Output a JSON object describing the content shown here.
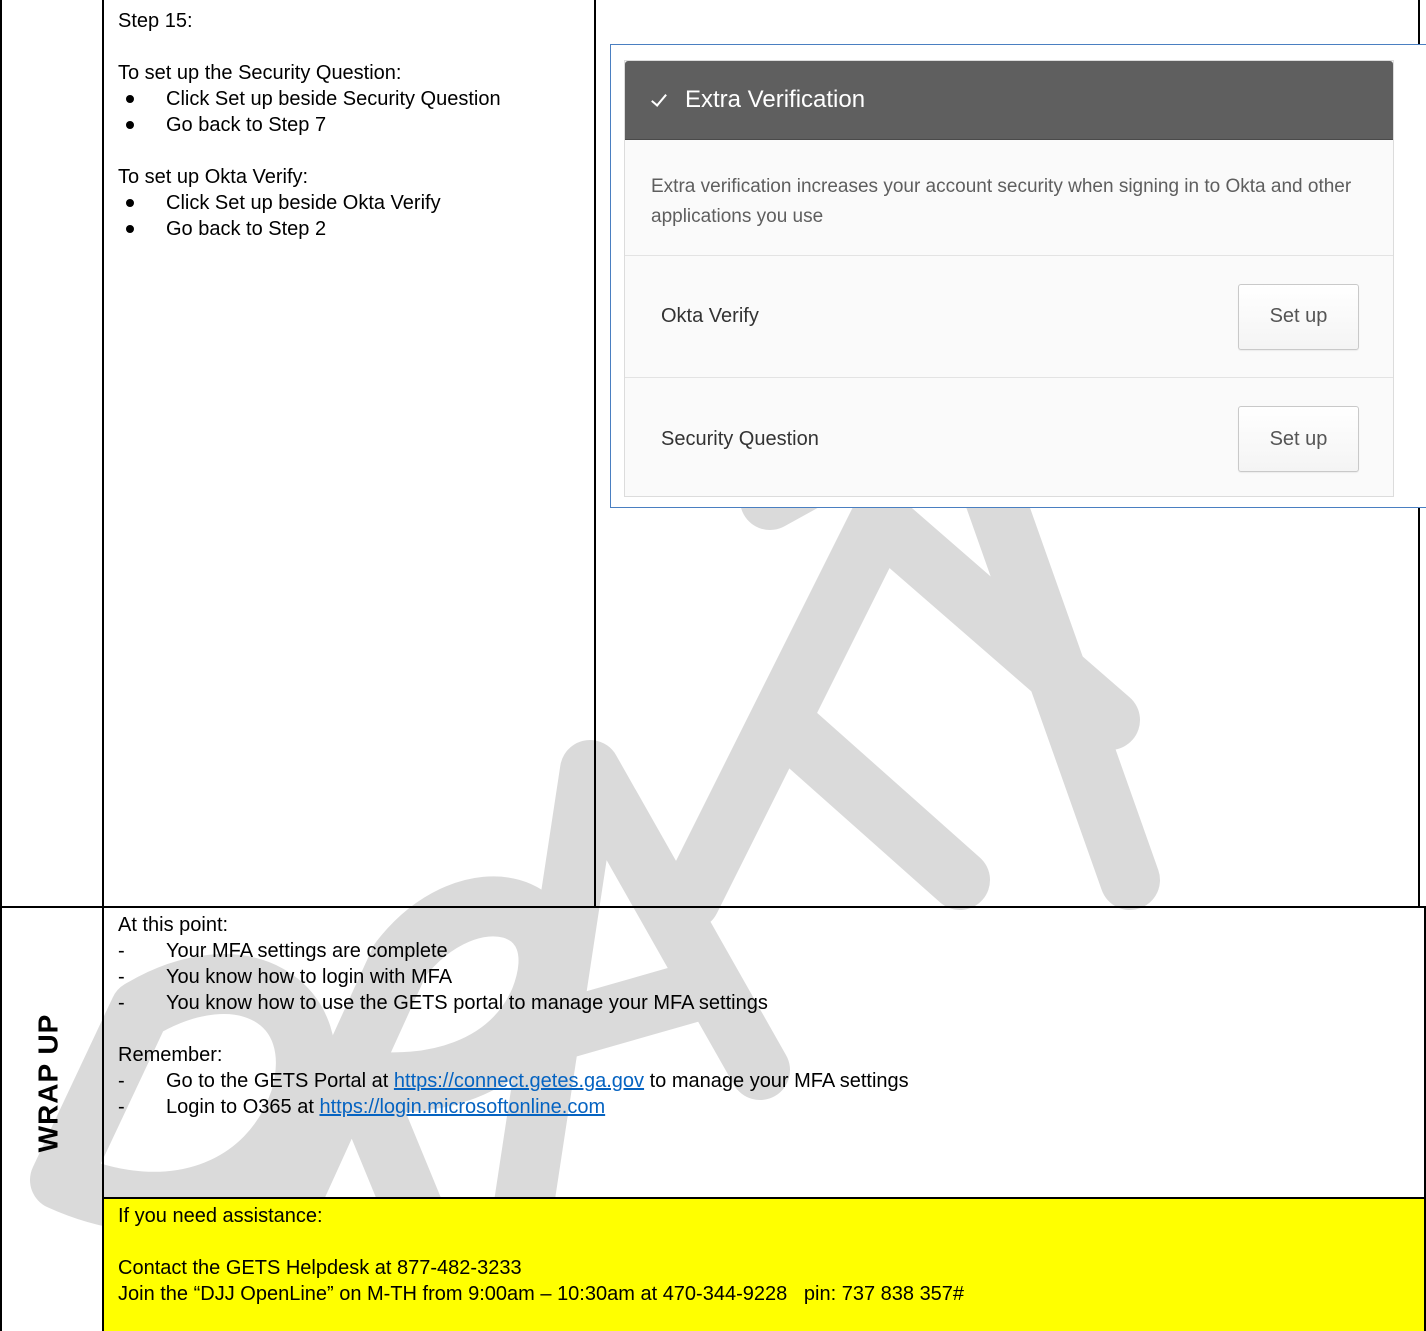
{
  "step_cell": {
    "step_title": "Step 15:",
    "security_intro": "To set up the Security Question:",
    "security_bullets": [
      "Click Set up beside Security Question",
      "Go back to Step 7"
    ],
    "okta_intro": "To set up Okta Verify:",
    "okta_bullets": [
      "Click Set up beside Okta Verify",
      "Go back to Step 2"
    ]
  },
  "okta_widget": {
    "header_title": "Extra Verification",
    "check_icon": "check-icon",
    "description": "Extra verification increases your account security when signing in to Okta and other applications you use",
    "factors": [
      {
        "name": "Okta Verify",
        "button": "Set up"
      },
      {
        "name": "Security Question",
        "button": "Set up"
      }
    ]
  },
  "wrap_up": {
    "section_label": "WRAP UP",
    "intro": "At this point:",
    "points": [
      "Your MFA settings are complete",
      "You know how to login with MFA",
      "You know how to use the GETS portal to manage your MFA settings"
    ],
    "remember_title": "Remember:",
    "remember_1_prefix": "Go to the GETS Portal at ",
    "remember_1_link": "https://connect.getes.ga.gov",
    "remember_1_suffix": " to manage your MFA settings",
    "remember_2_prefix": "Login to O365 at ",
    "remember_2_link": "https://login.microsoftonline.com"
  },
  "assistance": {
    "intro": "If you need assistance:",
    "helpdesk": "Contact the GETS Helpdesk at 877-482-3233",
    "openline": "Join the “DJJ OpenLine” on M-TH from 9:00am – 10:30am at 470-344-9228   pin: 737 838 357#",
    "highlight_color": "#ffff00"
  },
  "watermark": {
    "text": "DRAFT",
    "color": "#dadada"
  }
}
